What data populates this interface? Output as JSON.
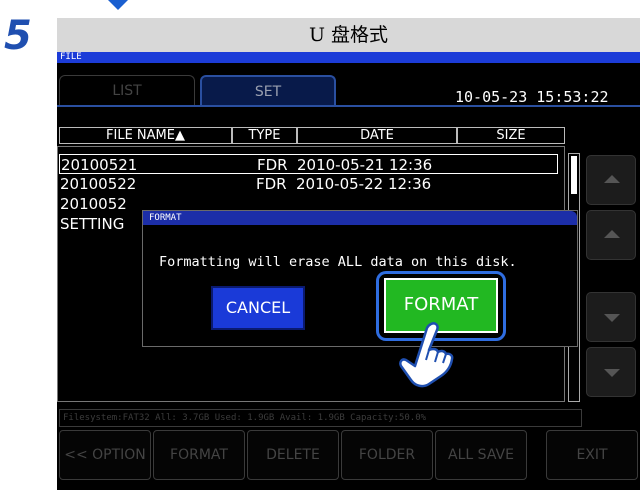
{
  "header": {
    "step_number": "5",
    "title": "U 盘格式"
  },
  "screen": {
    "mode_label": "FILE",
    "tabs": [
      {
        "label": "LIST",
        "active": false
      },
      {
        "label": "SET",
        "active": true
      }
    ],
    "clock": "10-05-23 15:53:22",
    "table": {
      "columns": [
        "FILE NAME▲",
        "TYPE",
        "DATE",
        "SIZE"
      ],
      "rows": [
        {
          "name": "20100521",
          "type": "FDR",
          "date": "2010-05-21 12:36",
          "selected": true
        },
        {
          "name": "20100522",
          "type": "FDR",
          "date": "2010-05-22 12:36",
          "selected": false
        },
        {
          "name": "2010052",
          "type": "",
          "date": "",
          "selected": false
        },
        {
          "name": "SETTING",
          "type": "",
          "date": "",
          "selected": false
        }
      ]
    },
    "status_line": "Filesystem:FAT32 All: 3.7GB Used: 1.9GB Avail: 1.9GB Capacity:50.0%",
    "bottom_buttons": [
      "<< OPTION",
      "FORMAT",
      "DELETE",
      "FOLDER",
      "ALL SAVE",
      "EXIT"
    ]
  },
  "dialog": {
    "title": "FORMAT",
    "message": "Formatting will erase ALL data on this disk.",
    "cancel_label": "CANCEL",
    "format_label": "FORMAT"
  },
  "colors": {
    "accent_blue": "#1c3cd8",
    "format_green": "#22b822",
    "highlight_ring": "#2f6de0"
  },
  "icons": {
    "pointer": "hand-pointer-icon",
    "scroll_up": "triangle-up-icon",
    "scroll_down": "triangle-down-icon"
  }
}
